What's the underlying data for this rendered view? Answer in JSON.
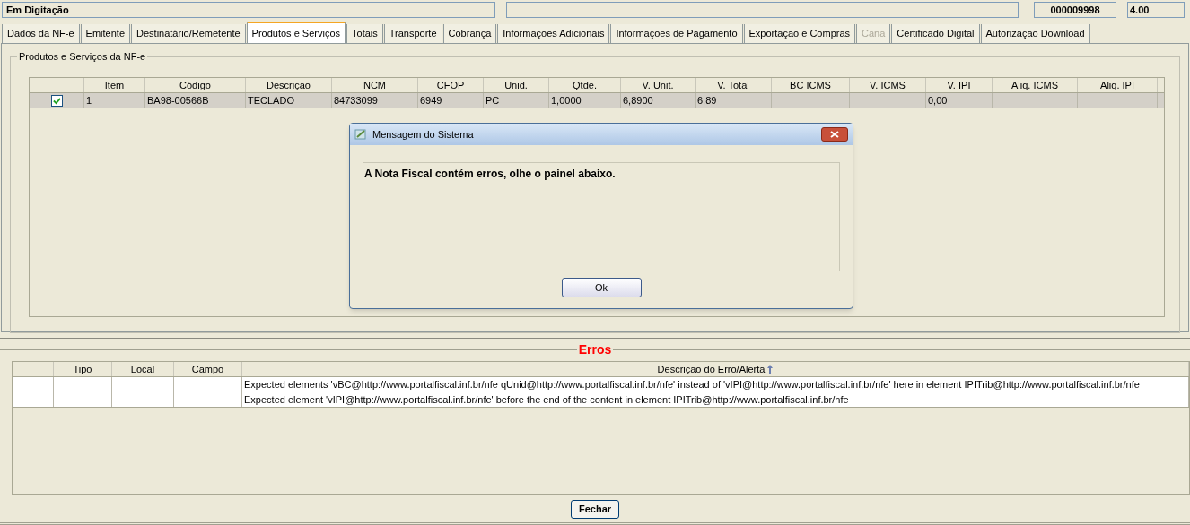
{
  "status_bar": {
    "state": "Em Digitação",
    "number": "000009998",
    "version": "4.00"
  },
  "tabs": [
    {
      "label": "Dados da NF-e",
      "selected": false,
      "disabled": false
    },
    {
      "label": "Emitente",
      "selected": false,
      "disabled": false
    },
    {
      "label": "Destinatário/Remetente",
      "selected": false,
      "disabled": false
    },
    {
      "label": "Produtos e Serviços",
      "selected": true,
      "disabled": false
    },
    {
      "label": "Totais",
      "selected": false,
      "disabled": false
    },
    {
      "label": "Transporte",
      "selected": false,
      "disabled": false
    },
    {
      "label": "Cobrança",
      "selected": false,
      "disabled": false
    },
    {
      "label": "Informações Adicionais",
      "selected": false,
      "disabled": false
    },
    {
      "label": "Informações de Pagamento",
      "selected": false,
      "disabled": false
    },
    {
      "label": "Exportação e Compras",
      "selected": false,
      "disabled": false
    },
    {
      "label": "Cana",
      "selected": false,
      "disabled": true
    },
    {
      "label": "Certificado Digital",
      "selected": false,
      "disabled": false
    },
    {
      "label": "Autorização Download",
      "selected": false,
      "disabled": false
    }
  ],
  "products": {
    "title": "Produtos e Serviços da NF-e",
    "columns": [
      "Item",
      "Código",
      "Descrição",
      "NCM",
      "CFOP",
      "Unid.",
      "Qtde.",
      "V. Unit.",
      "V. Total",
      "BC ICMS",
      "V. ICMS",
      "V. IPI",
      "Aliq. ICMS",
      "Aliq. IPI"
    ],
    "rows": [
      {
        "checked": true,
        "selected": true,
        "cells": [
          "1",
          "BA98-00566B",
          "TECLADO",
          "84733099",
          "6949",
          "PC",
          "1,0000",
          "6,8900",
          "6,89",
          "",
          "",
          "0,00",
          "",
          ""
        ]
      }
    ]
  },
  "dialog": {
    "title": "Mensagem do Sistema",
    "message": "A Nota Fiscal contém erros, olhe o painel abaixo.",
    "button": "Ok"
  },
  "errors": {
    "title": "Erros",
    "columns": [
      "",
      "Tipo",
      "Local",
      "Campo",
      "Descrição do Erro/Alerta"
    ],
    "rows": [
      [
        "",
        "",
        "",
        "",
        "Expected elements 'vBC@http://www.portalfiscal.inf.br/nfe qUnid@http://www.portalfiscal.inf.br/nfe' instead of 'vIPI@http://www.portalfiscal.inf.br/nfe' here in element IPITrib@http://www.portalfiscal.inf.br/nfe"
      ],
      [
        "",
        "",
        "",
        "",
        "Expected element 'vIPI@http://www.portalfiscal.inf.br/nfe' before the end of the content in element IPITrib@http://www.portalfiscal.inf.br/nfe"
      ]
    ]
  },
  "close_button": "Fechar"
}
